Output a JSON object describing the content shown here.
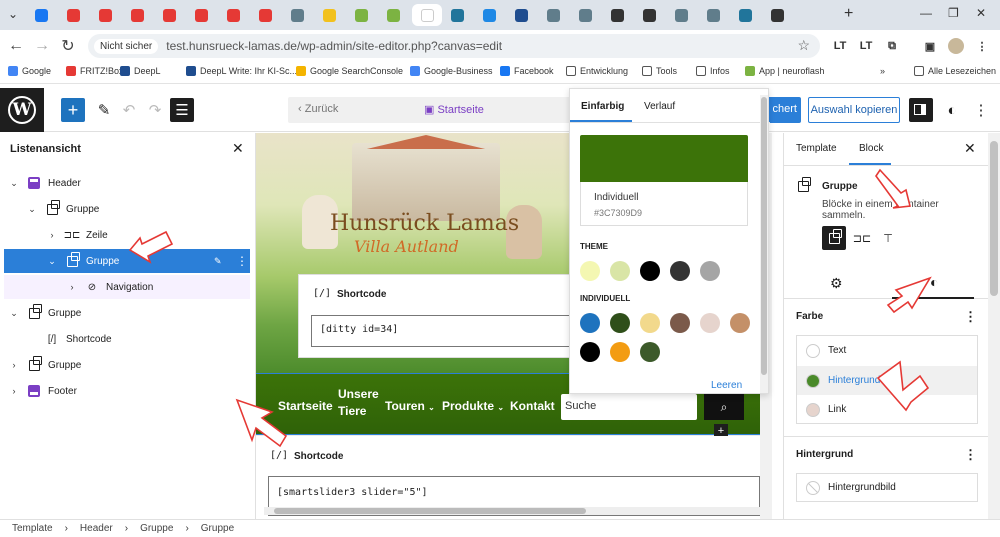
{
  "browser": {
    "tab_favicon_colors": [
      "#1877f2",
      "#e53935",
      "#e53935",
      "#e53935",
      "#e53935",
      "#e53935",
      "#e53935",
      "#e53935",
      "#607d8b",
      "#f2c11d",
      "#7cb342",
      "#7cb342",
      "#ffffff",
      "#21759b",
      "#1e88e5",
      "#1f4d8f",
      "#607d8b",
      "#607d8b",
      "#333333",
      "#333333",
      "#607d8b",
      "#607d8b",
      "#21759b",
      "#333333"
    ],
    "secure_label": "Nicht sicher",
    "url": "test.hunsrueck-lamas.de/wp-admin/site-editor.php?canvas=edit",
    "bookmarks": [
      "Google",
      "FRITZ!Box",
      "DeepL",
      "DeepL Write: Ihr KI-Sc...",
      "Google SearchConsole",
      "Google-Business",
      "Facebook",
      "Entwicklung",
      "Tools",
      "Infos",
      "App | neuroflash"
    ],
    "all_bookmarks": "Alle Lesezeichen"
  },
  "toolbar": {
    "back_label": "Zurück",
    "page_name": "Startseite",
    "save_label": "chert",
    "copy_label": "Auswahl kopieren"
  },
  "list_view": {
    "title": "Listenansicht",
    "items": [
      {
        "label": "Header",
        "icon": "template-part-icon"
      },
      {
        "label": "Gruppe",
        "icon": "group-icon"
      },
      {
        "label": "Zeile",
        "icon": "row-icon"
      },
      {
        "label": "Gruppe",
        "icon": "group-icon",
        "selected": true
      },
      {
        "label": "Navigation",
        "icon": "navigation-icon"
      },
      {
        "label": "Gruppe",
        "icon": "group-icon"
      },
      {
        "label": "Shortcode",
        "icon": "shortcode-icon"
      },
      {
        "label": "Gruppe",
        "icon": "group-icon"
      },
      {
        "label": "Footer",
        "icon": "template-part-icon"
      }
    ]
  },
  "canvas": {
    "brand_title": "Hunsrück Lamas",
    "brand_sub": "Villa Autland",
    "shortcode_label": "Shortcode",
    "shortcode_value": "[ditty id=34]",
    "menu": [
      "Startseite",
      "Unsere Tiere",
      "Touren",
      "Produkte",
      "Kontakt"
    ],
    "search_placeholder": "Suche",
    "shortcode2_label": "Shortcode",
    "shortcode2_value": "[smartslider3 slider=\"5\"]"
  },
  "color_popover": {
    "tab_solid": "Einfarbig",
    "tab_gradient": "Verlauf",
    "selected_name": "Individuell",
    "selected_hex": "#3C7309D9",
    "selected_color": "#3c7309",
    "theme_label": "THEME",
    "theme_colors": [
      "#f4f7b2",
      "#d9e5a6",
      "#000000",
      "#333333",
      "#a5a5a5"
    ],
    "custom_label": "INDIVIDUELL",
    "custom_colors": [
      "#1e73be",
      "#2f4f1a",
      "#f2d98c",
      "#7b5a4a",
      "#e6d4cd",
      "#c49068",
      "#000000",
      "#f39c12",
      "#3c5a2a"
    ],
    "reset_label": "Leeren"
  },
  "sidebar": {
    "tab_template": "Template",
    "tab_block": "Block",
    "block_name": "Gruppe",
    "block_desc": "Blöcke in einem Container sammeln.",
    "farbe_label": "Farbe",
    "farbe_items": [
      {
        "label": "Text",
        "color": "#ffffff"
      },
      {
        "label": "Hintergrund",
        "color": "#4a8a2a"
      },
      {
        "label": "Link",
        "color": "#e6d4cd"
      }
    ],
    "hintergrund_label": "Hintergrund",
    "hintergrund_bild": "Hintergrundbild"
  },
  "breadcrumb": [
    "Template",
    "Header",
    "Gruppe",
    "Gruppe"
  ]
}
